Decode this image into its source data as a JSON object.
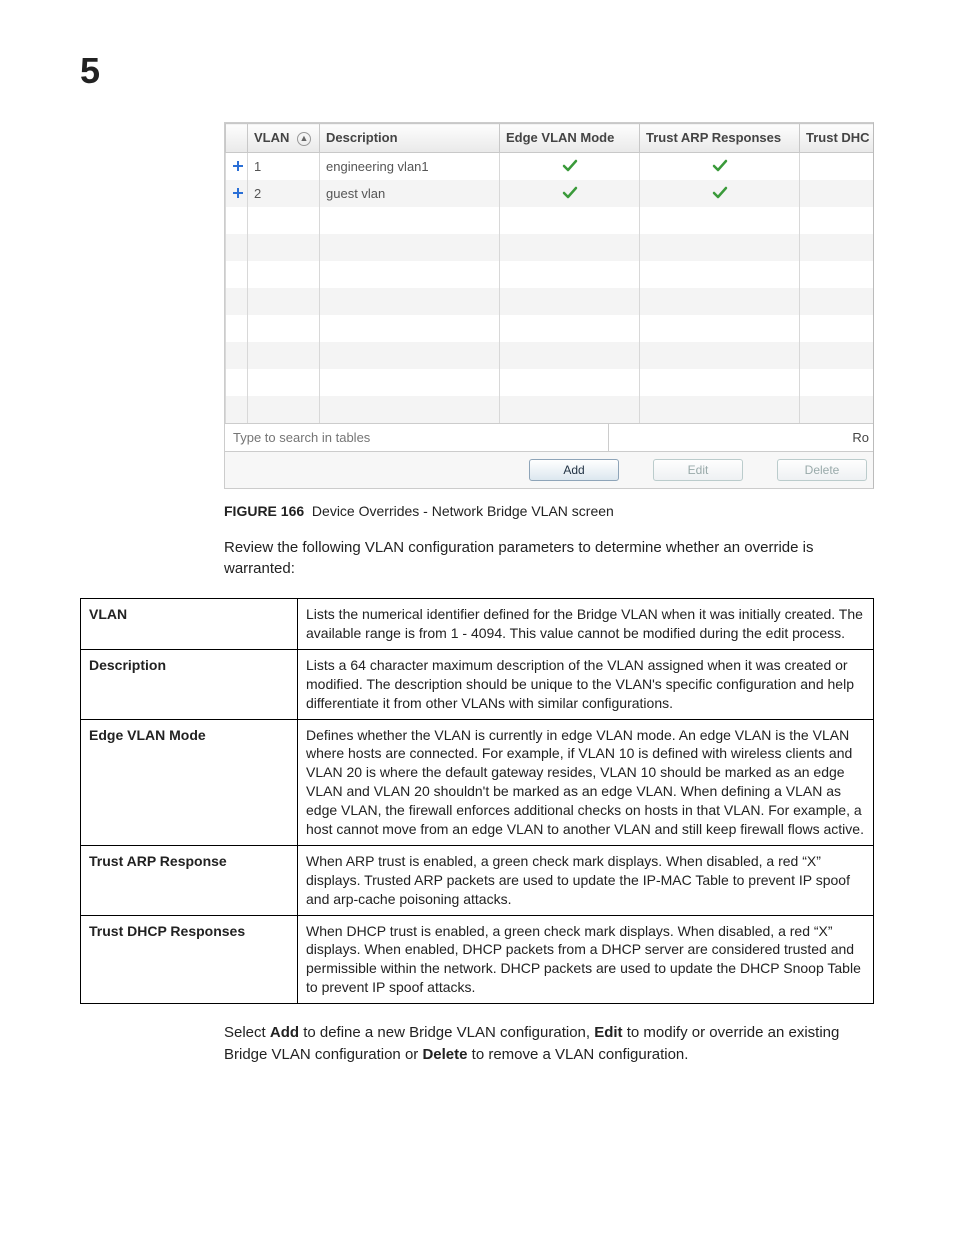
{
  "chapter_number": "5",
  "grid": {
    "headers": {
      "vlan": "VLAN",
      "description": "Description",
      "edge_mode": "Edge VLAN Mode",
      "trust_arp": "Trust ARP Responses",
      "trust_dhcp": "Trust DHC"
    },
    "rows": [
      {
        "vlan": "1",
        "description": "engineering vlan1",
        "edge_mode": true,
        "trust_arp": true
      },
      {
        "vlan": "2",
        "description": "guest vlan",
        "edge_mode": true,
        "trust_arp": true
      }
    ],
    "empty_row_count": 8,
    "search_placeholder": "Type to search in tables",
    "row_hint_right": "Ro",
    "buttons": {
      "add": "Add",
      "edit": "Edit",
      "delete": "Delete"
    }
  },
  "figure": {
    "label": "FIGURE 166",
    "title": "Device Overrides - Network Bridge VLAN screen"
  },
  "intro_paragraph": "Review the following VLAN configuration parameters to determine whether an override is warranted:",
  "definitions": [
    {
      "term": "VLAN",
      "desc": "Lists the numerical identifier defined for the Bridge VLAN when it was initially created. The available range is from 1 - 4094. This value cannot be modified during the edit process."
    },
    {
      "term": "Description",
      "desc": "Lists a 64 character maximum description of the VLAN assigned when it was created or modified. The description should be unique to the VLAN's specific configuration and help differentiate it from other VLANs with similar configurations."
    },
    {
      "term": "Edge VLAN Mode",
      "desc": "Defines whether the VLAN is currently in edge VLAN mode. An edge VLAN is the VLAN where hosts are connected. For example, if VLAN 10 is defined with wireless clients and VLAN 20 is where the default gateway resides, VLAN 10 should be marked as an edge VLAN and VLAN 20 shouldn't be marked as an edge VLAN. When defining a VLAN as edge VLAN, the firewall enforces additional checks on hosts in that VLAN. For example, a host cannot move from an edge VLAN to another VLAN and still keep firewall flows active."
    },
    {
      "term": "Trust ARP Response",
      "desc": "When ARP trust is enabled, a green check mark displays. When disabled, a red “X” displays. Trusted ARP packets are used to update the IP-MAC Table to prevent IP spoof and arp-cache poisoning attacks."
    },
    {
      "term": "Trust DHCP Responses",
      "desc": "When DHCP trust is enabled, a green check mark displays. When disabled, a red “X” displays. When enabled, DHCP packets from a DHCP server are considered trusted and permissible within the network. DHCP packets are used to update the DHCP Snoop Table to prevent IP spoof attacks."
    }
  ],
  "closing_paragraph": {
    "pre_add": "Select ",
    "add": "Add",
    "post_add": " to define a new Bridge VLAN configuration, ",
    "edit": "Edit",
    "post_edit": " to modify or override an existing Bridge VLAN configuration or ",
    "delete": "Delete",
    "post_delete": " to remove a VLAN configuration."
  }
}
